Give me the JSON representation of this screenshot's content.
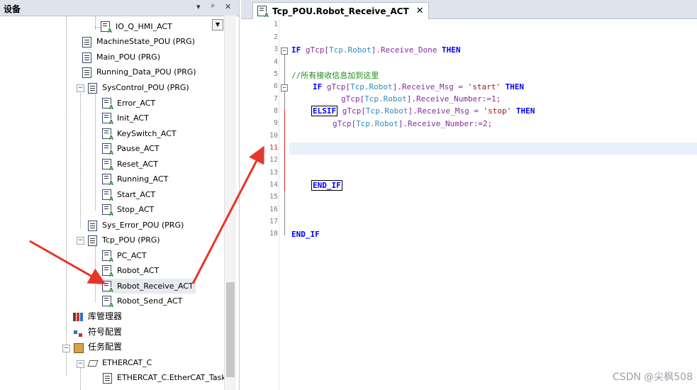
{
  "device_panel": {
    "title": "设备",
    "pin_label": "▾",
    "dock_label": "ᵖ",
    "close_label": "✕",
    "items": [
      {
        "label": "IO_Q_HMI_ACT"
      },
      {
        "label": "MachineState_POU (PRG)"
      },
      {
        "label": "Main_POU (PRG)"
      },
      {
        "label": "Running_Data_POU (PRG)"
      },
      {
        "label": "SysControl_POU (PRG)"
      },
      {
        "label": "Error_ACT"
      },
      {
        "label": "Init_ACT"
      },
      {
        "label": "KeySwitch_ACT"
      },
      {
        "label": "Pause_ACT"
      },
      {
        "label": "Reset_ACT"
      },
      {
        "label": "Running_ACT"
      },
      {
        "label": "Start_ACT"
      },
      {
        "label": "Stop_ACT"
      },
      {
        "label": "Sys_Error_POU (PRG)"
      },
      {
        "label": "Tcp_POU (PRG)"
      },
      {
        "label": "PC_ACT"
      },
      {
        "label": "Robot_ACT"
      },
      {
        "label": "Robot_Receive_ACT"
      },
      {
        "label": "Robot_Send_ACT"
      },
      {
        "label": "库管理器"
      },
      {
        "label": "符号配置"
      },
      {
        "label": "任务配置"
      },
      {
        "label": "ETHERCAT_C"
      },
      {
        "label": "ETHERCAT_C.EtherCAT_Task"
      }
    ]
  },
  "editor": {
    "tab_label": "Tcp_POU.Robot_Receive_ACT",
    "tab_close": "✕",
    "line_numbers": [
      "1",
      "2",
      "3",
      "4",
      "5",
      "6",
      "7",
      "8",
      "9",
      "10",
      "11",
      "12",
      "13",
      "14",
      "15",
      "16",
      "17",
      "18"
    ],
    "tokens": {
      "if": "IF",
      "then": "THEN",
      "elsif": "ELSIF",
      "end_if": "END_IF",
      "gtcp": "gTcp",
      "tcp_robot": "Tcp.Robot",
      "receive_done": ".Receive_Done",
      "receive_msg": ".Receive_Msg = ",
      "receive_number": ".Receive_Number:=",
      "comment": "//所有接收信息加到这里",
      "str_start": "'start'",
      "str_stop": "'stop'",
      "num1": "1",
      "num2": "2",
      "semi": ";"
    }
  },
  "watermark": "CSDN @尖枫508",
  "colors": {
    "keyword": "#0000ff",
    "comment": "#1e8c1e",
    "string": "#a31515",
    "identifier": "#8030a0",
    "annotation_arrow": "#e8352a"
  }
}
